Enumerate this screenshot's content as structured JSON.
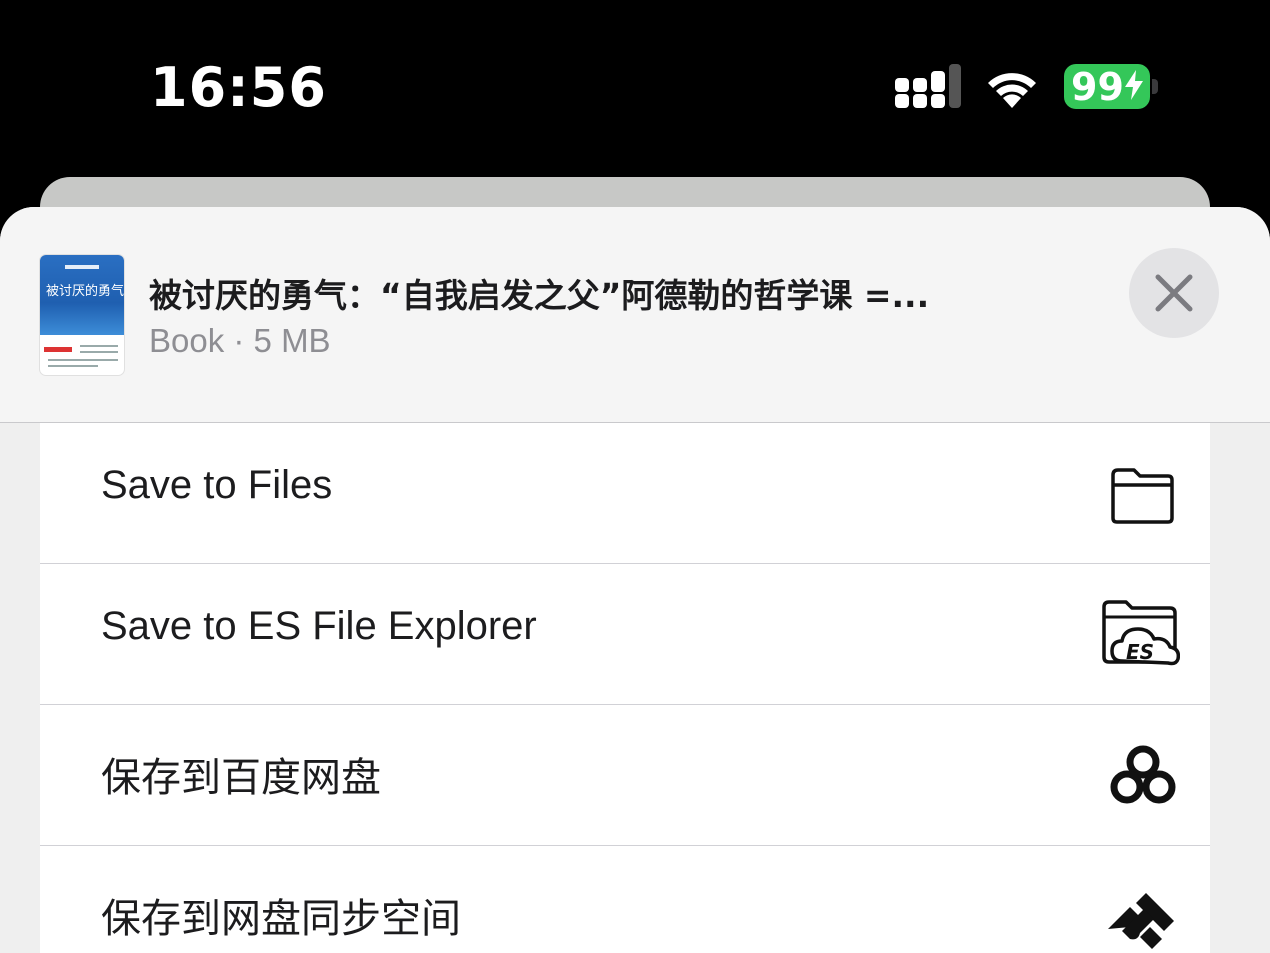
{
  "status_bar": {
    "time": "16:56",
    "battery_level": "99",
    "battery_color": "#34c759",
    "icons": [
      "signal-icon",
      "wifi-icon",
      "battery-icon"
    ]
  },
  "share_sheet": {
    "file_title": "被讨厌的勇气：“自我启发之父”阿德勒的哲学课 =...",
    "file_subtitle": "Book · 5 MB",
    "thumbnail": {
      "label": "被讨厌的勇气"
    },
    "close_icon": "close-icon",
    "actions": [
      {
        "label": "Save to Files",
        "icon": "folder-icon"
      },
      {
        "label": "Save to ES File Explorer",
        "icon": "es-file-explorer-icon"
      },
      {
        "label": "保存到百度网盘",
        "icon": "baidu-netdisk-icon"
      },
      {
        "label": "保存到网盘同步空间",
        "icon": "sync-space-icon"
      }
    ]
  }
}
